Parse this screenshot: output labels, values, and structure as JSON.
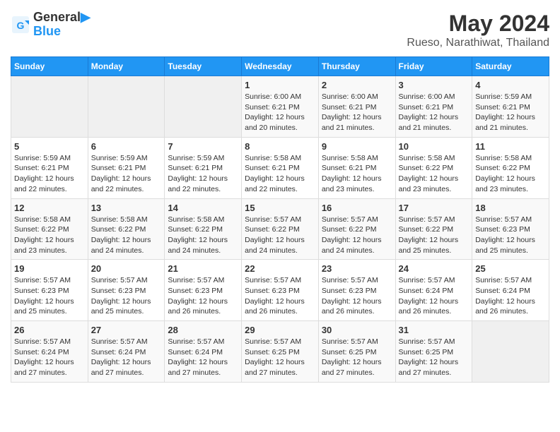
{
  "header": {
    "logo_line1": "General",
    "logo_line2": "Blue",
    "title": "May 2024",
    "subtitle": "Rueso, Narathiwat, Thailand"
  },
  "days_of_week": [
    "Sunday",
    "Monday",
    "Tuesday",
    "Wednesday",
    "Thursday",
    "Friday",
    "Saturday"
  ],
  "weeks": [
    {
      "days": [
        {
          "num": "",
          "info": ""
        },
        {
          "num": "",
          "info": ""
        },
        {
          "num": "",
          "info": ""
        },
        {
          "num": "1",
          "info": "Sunrise: 6:00 AM\nSunset: 6:21 PM\nDaylight: 12 hours\nand 20 minutes."
        },
        {
          "num": "2",
          "info": "Sunrise: 6:00 AM\nSunset: 6:21 PM\nDaylight: 12 hours\nand 21 minutes."
        },
        {
          "num": "3",
          "info": "Sunrise: 6:00 AM\nSunset: 6:21 PM\nDaylight: 12 hours\nand 21 minutes."
        },
        {
          "num": "4",
          "info": "Sunrise: 5:59 AM\nSunset: 6:21 PM\nDaylight: 12 hours\nand 21 minutes."
        }
      ]
    },
    {
      "days": [
        {
          "num": "5",
          "info": "Sunrise: 5:59 AM\nSunset: 6:21 PM\nDaylight: 12 hours\nand 22 minutes."
        },
        {
          "num": "6",
          "info": "Sunrise: 5:59 AM\nSunset: 6:21 PM\nDaylight: 12 hours\nand 22 minutes."
        },
        {
          "num": "7",
          "info": "Sunrise: 5:59 AM\nSunset: 6:21 PM\nDaylight: 12 hours\nand 22 minutes."
        },
        {
          "num": "8",
          "info": "Sunrise: 5:58 AM\nSunset: 6:21 PM\nDaylight: 12 hours\nand 22 minutes."
        },
        {
          "num": "9",
          "info": "Sunrise: 5:58 AM\nSunset: 6:21 PM\nDaylight: 12 hours\nand 23 minutes."
        },
        {
          "num": "10",
          "info": "Sunrise: 5:58 AM\nSunset: 6:22 PM\nDaylight: 12 hours\nand 23 minutes."
        },
        {
          "num": "11",
          "info": "Sunrise: 5:58 AM\nSunset: 6:22 PM\nDaylight: 12 hours\nand 23 minutes."
        }
      ]
    },
    {
      "days": [
        {
          "num": "12",
          "info": "Sunrise: 5:58 AM\nSunset: 6:22 PM\nDaylight: 12 hours\nand 23 minutes."
        },
        {
          "num": "13",
          "info": "Sunrise: 5:58 AM\nSunset: 6:22 PM\nDaylight: 12 hours\nand 24 minutes."
        },
        {
          "num": "14",
          "info": "Sunrise: 5:58 AM\nSunset: 6:22 PM\nDaylight: 12 hours\nand 24 minutes."
        },
        {
          "num": "15",
          "info": "Sunrise: 5:57 AM\nSunset: 6:22 PM\nDaylight: 12 hours\nand 24 minutes."
        },
        {
          "num": "16",
          "info": "Sunrise: 5:57 AM\nSunset: 6:22 PM\nDaylight: 12 hours\nand 24 minutes."
        },
        {
          "num": "17",
          "info": "Sunrise: 5:57 AM\nSunset: 6:22 PM\nDaylight: 12 hours\nand 25 minutes."
        },
        {
          "num": "18",
          "info": "Sunrise: 5:57 AM\nSunset: 6:23 PM\nDaylight: 12 hours\nand 25 minutes."
        }
      ]
    },
    {
      "days": [
        {
          "num": "19",
          "info": "Sunrise: 5:57 AM\nSunset: 6:23 PM\nDaylight: 12 hours\nand 25 minutes."
        },
        {
          "num": "20",
          "info": "Sunrise: 5:57 AM\nSunset: 6:23 PM\nDaylight: 12 hours\nand 25 minutes."
        },
        {
          "num": "21",
          "info": "Sunrise: 5:57 AM\nSunset: 6:23 PM\nDaylight: 12 hours\nand 26 minutes."
        },
        {
          "num": "22",
          "info": "Sunrise: 5:57 AM\nSunset: 6:23 PM\nDaylight: 12 hours\nand 26 minutes."
        },
        {
          "num": "23",
          "info": "Sunrise: 5:57 AM\nSunset: 6:23 PM\nDaylight: 12 hours\nand 26 minutes."
        },
        {
          "num": "24",
          "info": "Sunrise: 5:57 AM\nSunset: 6:24 PM\nDaylight: 12 hours\nand 26 minutes."
        },
        {
          "num": "25",
          "info": "Sunrise: 5:57 AM\nSunset: 6:24 PM\nDaylight: 12 hours\nand 26 minutes."
        }
      ]
    },
    {
      "days": [
        {
          "num": "26",
          "info": "Sunrise: 5:57 AM\nSunset: 6:24 PM\nDaylight: 12 hours\nand 27 minutes."
        },
        {
          "num": "27",
          "info": "Sunrise: 5:57 AM\nSunset: 6:24 PM\nDaylight: 12 hours\nand 27 minutes."
        },
        {
          "num": "28",
          "info": "Sunrise: 5:57 AM\nSunset: 6:24 PM\nDaylight: 12 hours\nand 27 minutes."
        },
        {
          "num": "29",
          "info": "Sunrise: 5:57 AM\nSunset: 6:25 PM\nDaylight: 12 hours\nand 27 minutes."
        },
        {
          "num": "30",
          "info": "Sunrise: 5:57 AM\nSunset: 6:25 PM\nDaylight: 12 hours\nand 27 minutes."
        },
        {
          "num": "31",
          "info": "Sunrise: 5:57 AM\nSunset: 6:25 PM\nDaylight: 12 hours\nand 27 minutes."
        },
        {
          "num": "",
          "info": ""
        }
      ]
    }
  ]
}
